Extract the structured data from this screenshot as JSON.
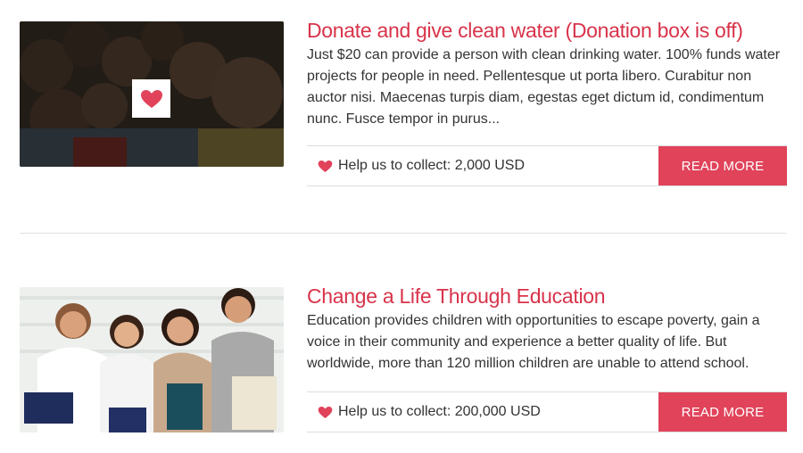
{
  "colors": {
    "accent": "#e0435a",
    "title": "#d8334a",
    "text": "#333333",
    "border": "#dddddd"
  },
  "campaigns": [
    {
      "title": "Donate and give clean water (Donation box is off)",
      "description": "Just $20 can provide a person with clean drinking water. 100% funds water projects for people in need. Pellentesque ut porta libero. Curabitur non auctor nisi. Maecenas turpis diam, egestas eget dictum id, condimentum nunc. Fusce tempor in purus...",
      "goal_text": "Help us to collect: 2,000 USD",
      "button_label": "READ MORE",
      "image_icon": "heart-icon"
    },
    {
      "title": "Change a Life Through Education",
      "description": "Education provides children with opportunities to escape poverty, gain a voice in their community and experience a better quality of life. But worldwide, more than 120 million children are unable to attend school.",
      "goal_text": "Help us to collect: 200,000 USD",
      "button_label": "READ MORE"
    }
  ]
}
